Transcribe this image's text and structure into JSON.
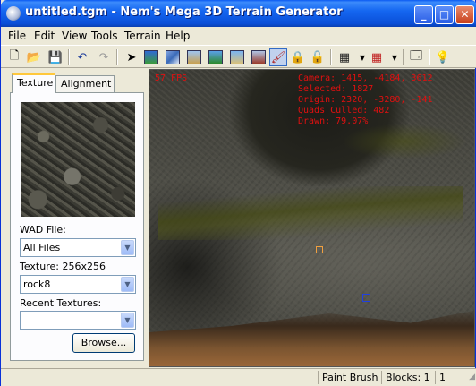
{
  "window": {
    "title": "untitled.tgm - Nem's Mega 3D Terrain Generator"
  },
  "menu": [
    {
      "label": "File",
      "accel": "F"
    },
    {
      "label": "Edit",
      "accel": "E"
    },
    {
      "label": "View",
      "accel": "V"
    },
    {
      "label": "Tools",
      "accel": "T"
    },
    {
      "label": "Terrain",
      "accel": "T"
    },
    {
      "label": "Help",
      "accel": "H"
    }
  ],
  "toolbar": {
    "icons": [
      "new-icon",
      "open-icon",
      "save-icon",
      "undo-icon",
      "redo-icon",
      "select-arrow-icon",
      "terrain-1-icon",
      "terrain-2-icon",
      "terrain-3-icon",
      "terrain-4-icon",
      "terrain-5-icon",
      "terrain-6-icon",
      "paint-brush-icon",
      "lock-icon",
      "unlock-icon",
      "grid-icon",
      "grid-red-icon",
      "properties-icon",
      "lightbulb-icon"
    ],
    "active_tool": "Paint Brush"
  },
  "panel": {
    "tabs": [
      "Texture",
      "Alignment"
    ],
    "active_tab": "Texture",
    "wad_label": "WAD File:",
    "wad_value": "All Files",
    "texture_label": "Texture: 256x256",
    "texture_value": "rock8",
    "recent_label": "Recent Textures:",
    "recent_value": "",
    "browse_label": "Browse..."
  },
  "viewport": {
    "fps": "57 FPS",
    "camera": "Camera: 1415, -4184, 3612",
    "selected": "Selected: 1827",
    "origin": "Origin: 2320, -3280, -141",
    "culled": "Quads Culled: 482",
    "drawn": "Drawn: 79.07%"
  },
  "status": {
    "tool": "Paint Brush",
    "blocks": "Blocks: 1",
    "extra": "1"
  },
  "colors": {
    "hud": "#e01010",
    "titlebar": "#0a59f2"
  }
}
